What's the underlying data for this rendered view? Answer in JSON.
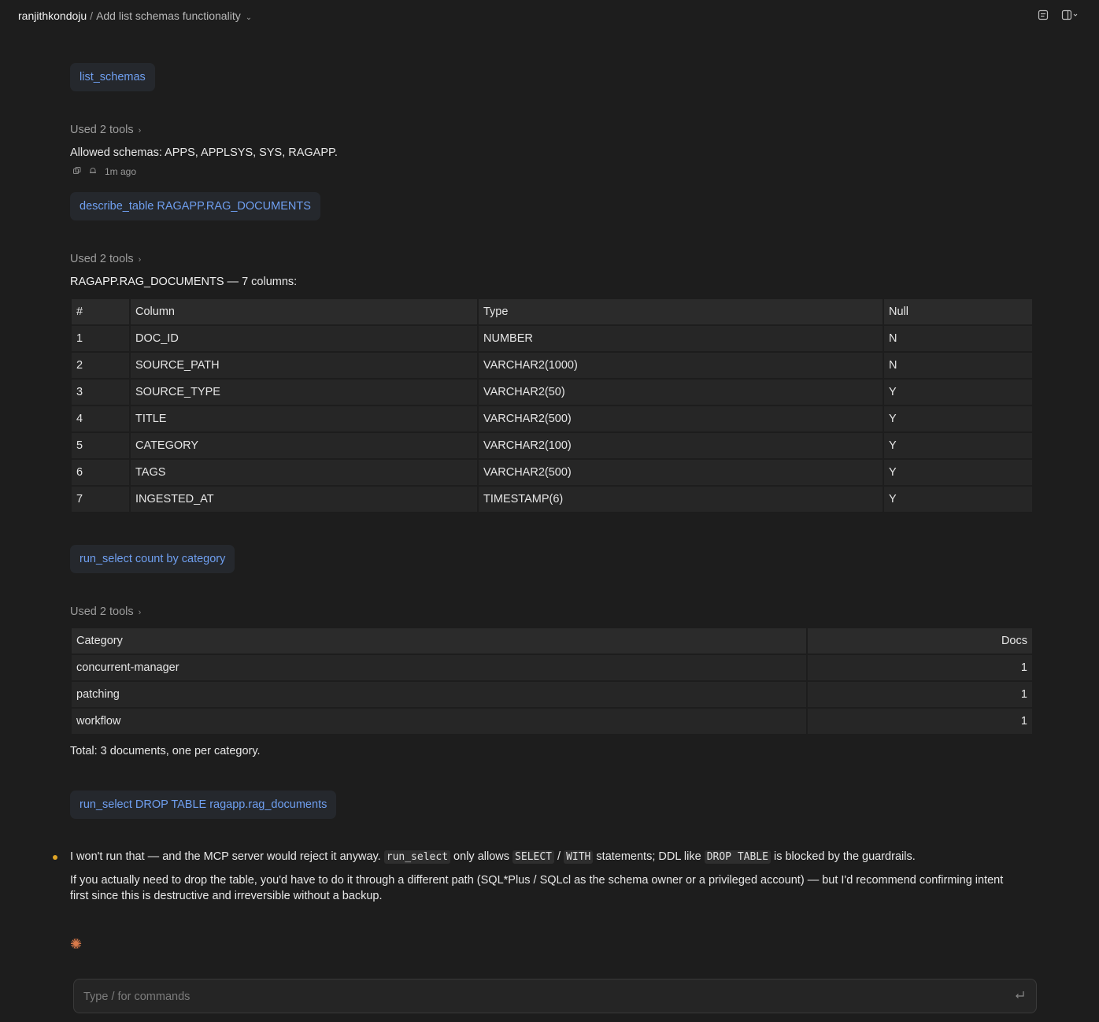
{
  "header": {
    "user": "ranjithkondoju",
    "separator": "/",
    "title": "Add list schemas functionality"
  },
  "blocks": {
    "tool1_label": "list_schemas",
    "used1": "Used 2 tools",
    "allowed_text": "Allowed schemas: APPS, APPLSYS, SYS, RAGAPP.",
    "timestamp": "1m ago",
    "tool2_label": "describe_table RAGAPP.RAG_DOCUMENTS",
    "used2": "Used 2 tools",
    "table_caption_strong": "RAGAPP.RAG_DOCUMENTS",
    "table_caption_rest": " — 7 columns:",
    "tool3_label": "run_select count by category",
    "used3": "Used 2 tools",
    "total_text": "Total: 3 documents, one per category.",
    "tool4_label": "run_select DROP TABLE ragapp.rag_documents"
  },
  "columns_table": {
    "headers": [
      "#",
      "Column",
      "Type",
      "Null"
    ],
    "rows": [
      [
        "1",
        "DOC_ID",
        "NUMBER",
        "N"
      ],
      [
        "2",
        "SOURCE_PATH",
        "VARCHAR2(1000)",
        "N"
      ],
      [
        "3",
        "SOURCE_TYPE",
        "VARCHAR2(50)",
        "Y"
      ],
      [
        "4",
        "TITLE",
        "VARCHAR2(500)",
        "Y"
      ],
      [
        "5",
        "CATEGORY",
        "VARCHAR2(100)",
        "Y"
      ],
      [
        "6",
        "TAGS",
        "VARCHAR2(500)",
        "Y"
      ],
      [
        "7",
        "INGESTED_AT",
        "TIMESTAMP(6)",
        "Y"
      ]
    ]
  },
  "category_table": {
    "headers": [
      "Category",
      "Docs"
    ],
    "rows": [
      [
        "concurrent-manager",
        "1"
      ],
      [
        "patching",
        "1"
      ],
      [
        "workflow",
        "1"
      ]
    ]
  },
  "reply": {
    "p1_a": "I won't run that — and the MCP server would reject it anyway. ",
    "p1_code1": "run_select",
    "p1_b": " only allows ",
    "p1_code2": "SELECT",
    "p1_c": " / ",
    "p1_code3": "WITH",
    "p1_d": " statements; DDL like ",
    "p1_code4": "DROP TABLE",
    "p1_e": " is blocked by the guardrails.",
    "p2_line1": "If you actually need to drop the table, you'd have to do it through a different path (SQL*Plus / SQLcl as the schema owner or a privileged account) — but I'd recommend confirming intent",
    "p2_line2": "first since this is destructive and irreversible without a backup."
  },
  "composer": {
    "placeholder": "Type / for commands"
  },
  "colors": {
    "background": "#1d1d1d",
    "pill_text": "#6f9ff0",
    "bullet": "#e0a526",
    "spinner": "#d97a4a"
  }
}
